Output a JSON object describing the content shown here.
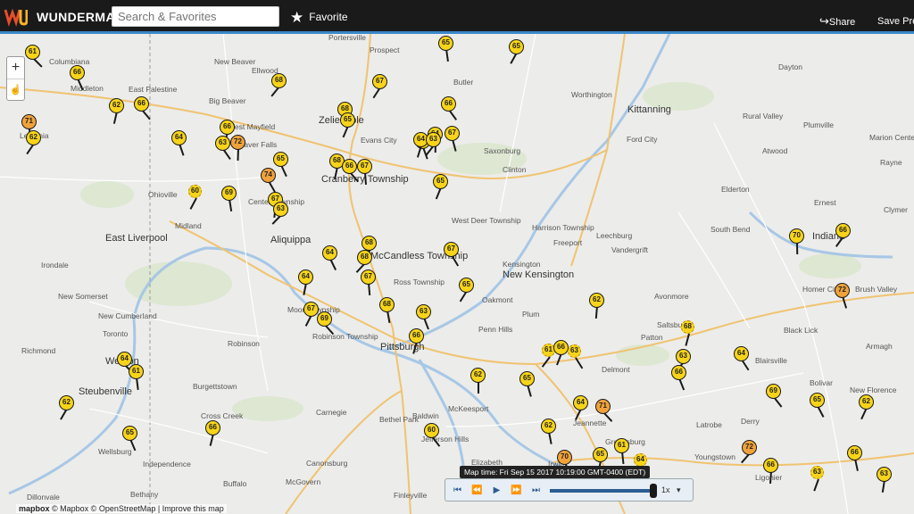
{
  "header": {
    "brand": "WUNDERMAP",
    "search_placeholder": "Search & Favorites",
    "favorite_label": "Favorite",
    "share_label": "Share",
    "save_label": "Save Pre"
  },
  "map": {
    "attribution": "© Mapbox © OpenStreetMap | Improve this map",
    "attribution_brand": "mapbox",
    "place_labels": [
      "Portersville",
      "Prospect",
      "Columbiana",
      "New Beaver",
      "Ellwood",
      "Middleton",
      "East Palestine",
      "Big Beaver",
      "West Mayfield",
      "Beaver Falls",
      "Zelienople",
      "Evans City",
      "Butler",
      "Worthington",
      "Kittanning",
      "Dayton",
      "Rural Valley",
      "Plumville",
      "Ford City",
      "Atwood",
      "Marion Center",
      "Rayne",
      "Leetonia",
      "Saxonburg",
      "Clinton",
      "Elderton",
      "Ohioville",
      "Cranberry Township",
      "Center Township",
      "Midland",
      "East Liverpool",
      "West Deer Township",
      "Harrison Township",
      "Freeport",
      "Leechburg",
      "Vandergrift",
      "South Bend",
      "Ernest",
      "Indiana",
      "Clymer",
      "Irondale",
      "Aliquippa",
      "McCandless Township",
      "Ross Township",
      "Kensington",
      "New Kensington",
      "Homer City",
      "Brush Valley",
      "New Somerset",
      "New Cumberland",
      "Moon Township",
      "Oakmont",
      "Plum",
      "Avonmore",
      "Toronto",
      "Robinson",
      "Robinson Township",
      "Pittsburgh",
      "Penn Hills",
      "Saltsburg",
      "Black Lick",
      "Patton",
      "Armagh",
      "Richmond",
      "Weirton",
      "Blairsville",
      "Steubenville",
      "Delmont",
      "Burgettstown",
      "Bolivar",
      "New Florence",
      "Cross Creek",
      "Carnegie",
      "Bethel Park",
      "Baldwin",
      "McKeesport",
      "Jeannette",
      "Greensburg",
      "Latrobe",
      "Derry",
      "Wellsburg",
      "Jefferson Hills",
      "Youngstown",
      "Independence",
      "Canonsburg",
      "Elizabeth",
      "Irwin",
      "Ligonier",
      "Buffalo",
      "McGovern",
      "Finleyville",
      "Bethany",
      "Dillonvale"
    ],
    "stations": [
      "61",
      "65",
      "65",
      "66",
      "62",
      "66",
      "71",
      "62",
      "64",
      "66",
      "63",
      "72",
      "68",
      "68",
      "65",
      "74",
      "67",
      "63",
      "69",
      "60",
      "65",
      "68",
      "66",
      "67",
      "67",
      "66",
      "64",
      "66",
      "64",
      "63",
      "67",
      "65",
      "67",
      "68",
      "68",
      "68",
      "67",
      "64",
      "64",
      "69",
      "67",
      "65",
      "63",
      "66",
      "60",
      "62",
      "61",
      "65",
      "66",
      "63",
      "62",
      "63",
      "62",
      "64",
      "70",
      "65",
      "71",
      "61",
      "64",
      "66",
      "68",
      "69",
      "70",
      "66",
      "72",
      "63",
      "64",
      "66",
      "72",
      "66",
      "62",
      "65",
      "63",
      "64",
      "61",
      "62",
      "65",
      "66"
    ],
    "zoom_in": "+",
    "zoom_out": "☝"
  },
  "player": {
    "map_time": "Map time: Fri Sep 15 2017 10:19:00 GMT-0400 (EDT)",
    "speed": "1x",
    "buttons": [
      "⏮",
      "⏪",
      "▶",
      "⏩",
      "⏭"
    ]
  },
  "colors": {
    "header_bg": "#1a1a1a",
    "accent": "#3a87c8",
    "pin_yellow": "#f7d419",
    "pin_orange": "#f0a23a"
  }
}
